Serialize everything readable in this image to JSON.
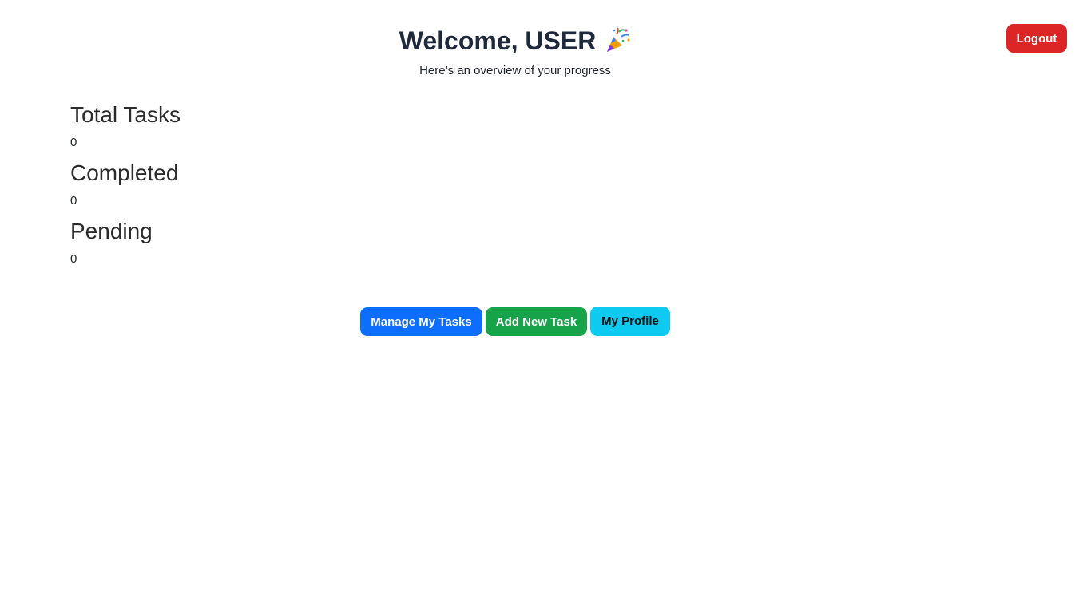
{
  "header": {
    "title": "Welcome, USER",
    "emoji": "🎉",
    "subtitle": "Here’s an overview of your progress"
  },
  "logout_label": "Logout",
  "stats": [
    {
      "label": "Total Tasks",
      "value": "0"
    },
    {
      "label": "Completed",
      "value": "0"
    },
    {
      "label": "Pending",
      "value": "0"
    }
  ],
  "actions": {
    "manage_label": "Manage My Tasks",
    "add_label": "Add New Task",
    "profile_label": "My Profile"
  },
  "colors": {
    "logout": "#dc2626",
    "manage": "#0d6efd",
    "add": "#16a34a",
    "profile": "#0dcaf0"
  }
}
